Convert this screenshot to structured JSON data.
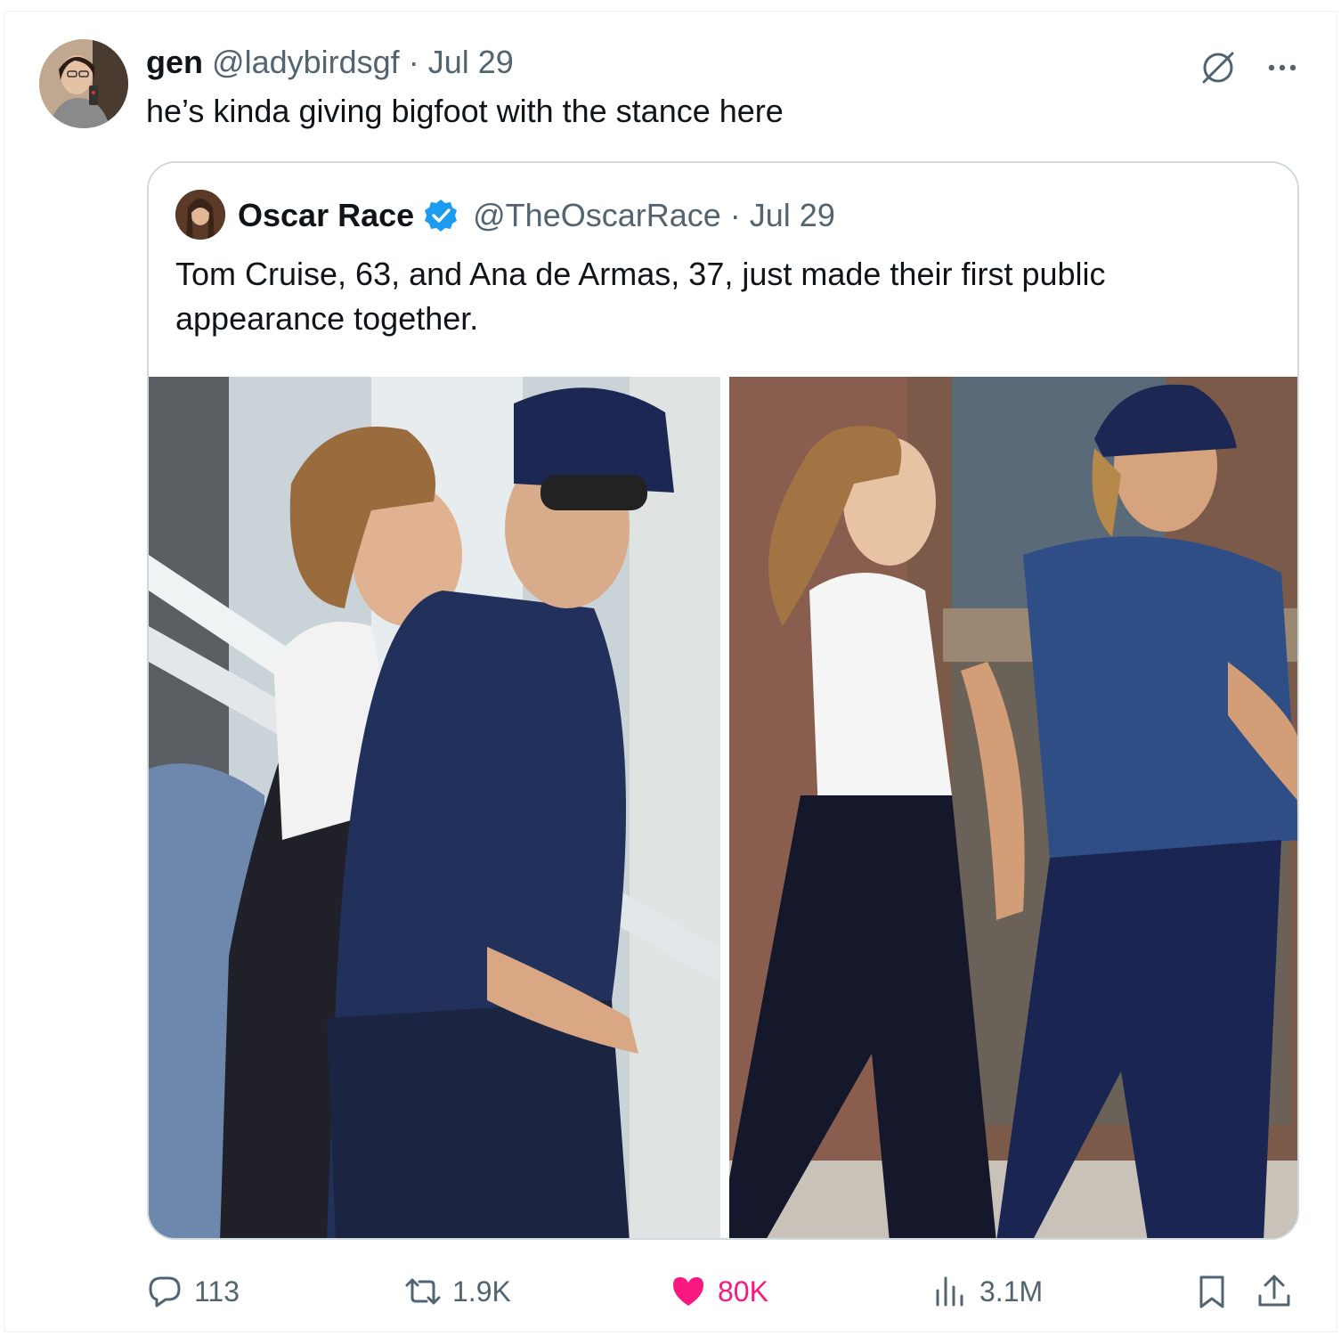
{
  "post": {
    "display_name": "gen",
    "handle": "@ladybirdsgf",
    "separator": "·",
    "date": "Jul 29",
    "text": "he’s kinda giving bigfoot with the stance here"
  },
  "top_actions": {
    "grok_icon": "grok-icon",
    "more_icon": "more-icon"
  },
  "quoted": {
    "display_name": "Oscar Race",
    "verified": true,
    "handle": "@TheOscarRace",
    "separator": "·",
    "date": "Jul 29",
    "text": "Tom Cruise, 63, and Ana de Armas, 37, just made their first public appearance together."
  },
  "actions": {
    "replies": "113",
    "reposts": "1.9K",
    "likes": "80K",
    "views": "3.1M"
  },
  "colors": {
    "text": "#0f1419",
    "muted": "#536471",
    "border": "#cfd9de",
    "like_active": "#f91880",
    "verified": "#1d9bf0"
  }
}
